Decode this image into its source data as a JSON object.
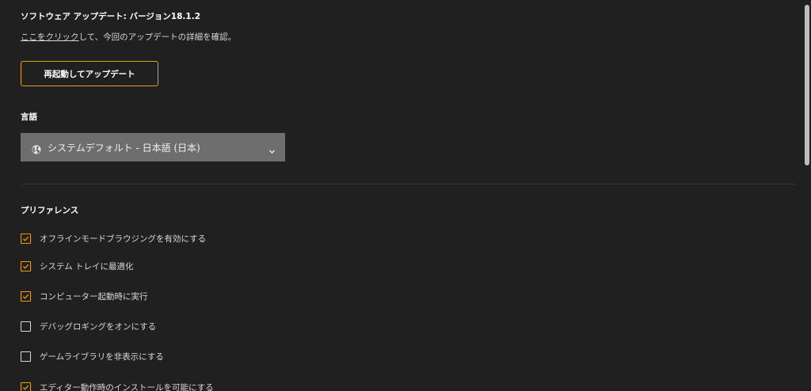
{
  "update": {
    "version_title": "ソフトウェア アップデート: バージョン18.1.2",
    "details_link": "ここをクリック",
    "details_rest": "して、今回のアップデートの詳細を確認。",
    "restart_label": "再起動してアップデート"
  },
  "language": {
    "heading": "言語",
    "selected": "システムデフォルト - 日本語 (日本)",
    "globe_icon": "globe-icon",
    "chevron_icon": "chevron-down-icon"
  },
  "preferences": {
    "heading": "プリファレンス",
    "items": [
      {
        "label": "オフラインモードブラウジングを有効にする",
        "checked": true
      },
      {
        "label": "システム トレイに最適化",
        "checked": true
      },
      {
        "label": "コンピューター起動時に実行",
        "checked": true
      },
      {
        "label": "デバッグロギングをオンにする",
        "checked": false
      },
      {
        "label": "ゲームライブラリを非表示にする",
        "checked": false
      },
      {
        "label": "エディター動作時のインストールを可能にする",
        "checked": true
      }
    ]
  },
  "colors": {
    "background": "#202020",
    "accent": "#e0a10c",
    "select_bg": "#6e6e6e"
  }
}
